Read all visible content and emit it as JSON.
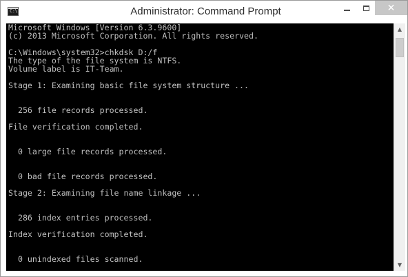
{
  "window": {
    "title": "Administrator: Command Prompt",
    "icon": "command-prompt-icon",
    "icon_text": "C:\\.",
    "controls": {
      "minimize": "minimize-icon",
      "maximize": "maximize-icon",
      "close_glyph": "✕"
    },
    "colors": {
      "console_background": "#000000",
      "console_text": "#c0c0c0",
      "close_button": "#c7c7c7"
    }
  },
  "console": {
    "lines": [
      "Microsoft Windows [Version 6.3.9600]",
      "(c) 2013 Microsoft Corporation. All rights reserved.",
      "",
      "C:\\Windows\\system32>chkdsk D:/f",
      "The type of the file system is NTFS.",
      "Volume label is IT-Team.",
      "",
      "Stage 1: Examining basic file system structure ...",
      "",
      "",
      "  256 file records processed.",
      "",
      "File verification completed.",
      "",
      "",
      "  0 large file records processed.",
      "",
      "",
      "  0 bad file records processed.",
      "",
      "Stage 2: Examining file name linkage ...",
      "",
      "",
      "  286 index entries processed.",
      "",
      "Index verification completed.",
      "",
      "",
      "  0 unindexed files scanned."
    ]
  },
  "scrollbar": {
    "up_arrow": "▲",
    "down_arrow": "▼"
  }
}
